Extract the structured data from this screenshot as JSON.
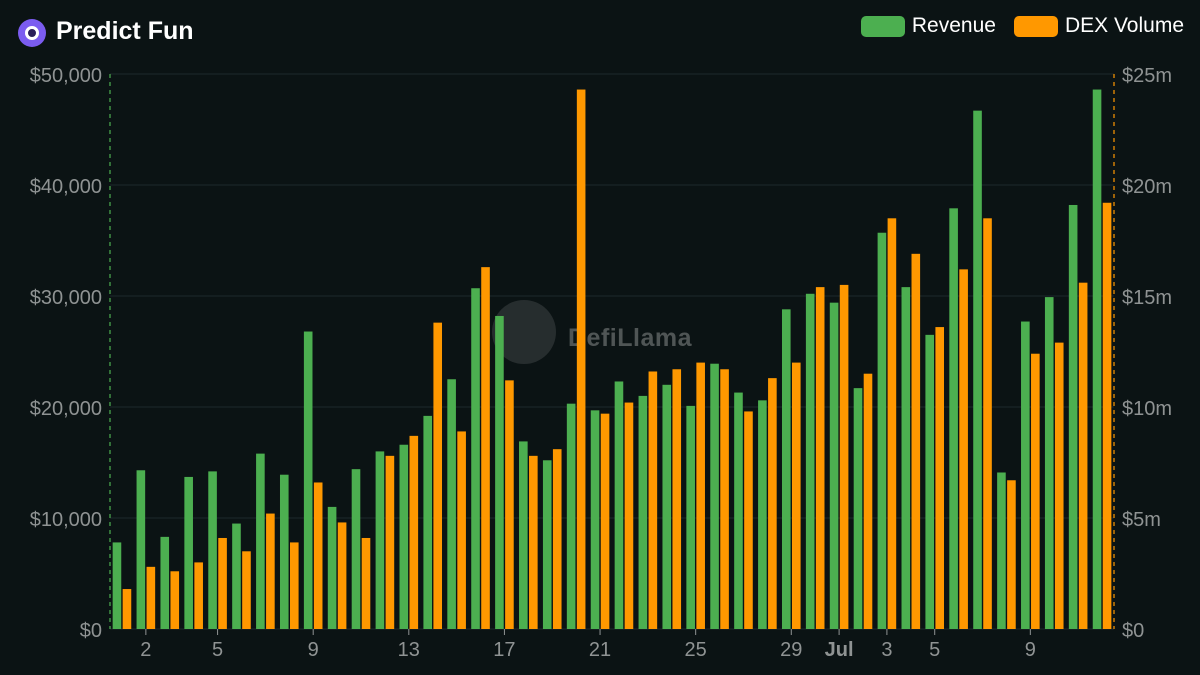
{
  "header": {
    "title": "Predict Fun",
    "logo_icon": "predict-fun-logo-icon"
  },
  "watermark": "DefiLlama",
  "colors": {
    "background": "#0b1314",
    "revenue": "#4caf50",
    "dex_volume": "#ff9800",
    "grid": "#1e2a2b",
    "tick_text": "#8f9393"
  },
  "chart_data": {
    "type": "bar",
    "title": "Predict Fun",
    "legend_position": "top-right",
    "grid": true,
    "x": [
      "",
      "2",
      "",
      "",
      "5",
      "",
      "",
      "",
      "9",
      "",
      "",
      "",
      "13",
      "",
      "",
      "",
      "17",
      "",
      "",
      "",
      "21",
      "",
      "",
      "",
      "25",
      "",
      "",
      "",
      "29",
      "",
      "Jul",
      "",
      "3",
      "",
      "5",
      "",
      "",
      "",
      "9",
      "",
      "",
      ""
    ],
    "x_tick_labels": [
      "2",
      "5",
      "9",
      "13",
      "17",
      "21",
      "25",
      "29",
      "Jul",
      "3",
      "5",
      "9"
    ],
    "y_left": {
      "label": "",
      "ylim": [
        0,
        50000
      ],
      "ticks": [
        "$0",
        "$10,000",
        "$20,000",
        "$30,000",
        "$40,000",
        "$50,000"
      ]
    },
    "y_right": {
      "label": "",
      "ylim": [
        0,
        25
      ],
      "ticks": [
        "$0",
        "$5m",
        "$10m",
        "$15m",
        "$20m",
        "$25m"
      ]
    },
    "series": [
      {
        "name": "Revenue",
        "axis": "left",
        "color": "#4caf50",
        "values": [
          7800,
          14300,
          8300,
          13700,
          14200,
          9500,
          15800,
          13900,
          26800,
          11000,
          14400,
          16000,
          16600,
          19200,
          22500,
          30700,
          28200,
          16900,
          15200,
          20300,
          19700,
          22300,
          21000,
          22000,
          20100,
          23900,
          21300,
          20600,
          28800,
          30200,
          29400,
          21700,
          35700,
          30800,
          26500,
          37900,
          46700,
          14100,
          27700,
          29900,
          38200,
          48600
        ]
      },
      {
        "name": "DEX Volume",
        "axis": "right",
        "color": "#ff9800",
        "values": [
          1.8,
          2.8,
          2.6,
          3.0,
          4.1,
          3.5,
          5.2,
          3.9,
          6.6,
          4.8,
          4.1,
          7.8,
          8.7,
          13.8,
          8.9,
          16.3,
          11.2,
          7.8,
          8.1,
          24.3,
          9.7,
          10.2,
          11.6,
          11.7,
          12.0,
          11.7,
          9.8,
          11.3,
          12.0,
          15.4,
          15.5,
          11.5,
          18.5,
          16.9,
          13.6,
          16.2,
          18.5,
          6.7,
          12.4,
          12.9,
          15.6,
          19.2
        ]
      }
    ]
  }
}
